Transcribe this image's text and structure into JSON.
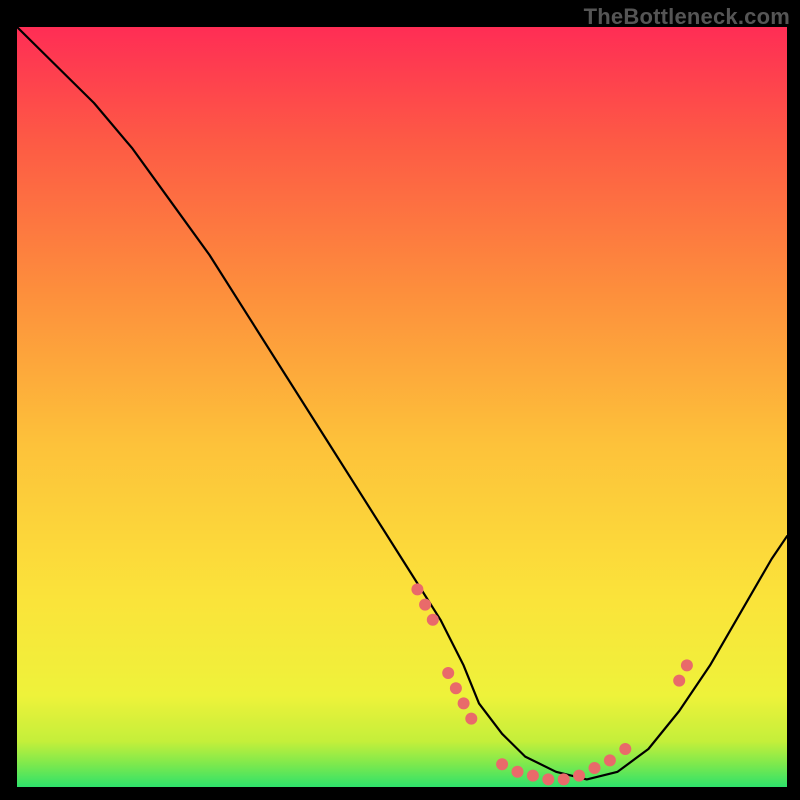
{
  "watermark": "TheBottleneck.com",
  "colors": {
    "page_bg": "#000000",
    "gradient_top": "#ff2d55",
    "gradient_mid": "#fbe33a",
    "gradient_bottom": "#2ee26b",
    "curve": "#000000",
    "dot": "#e96a6a"
  },
  "chart_data": {
    "type": "line",
    "title": "",
    "xlabel": "",
    "ylabel": "",
    "xlim": [
      0,
      100
    ],
    "ylim": [
      0,
      100
    ],
    "grid": false,
    "legend": false,
    "series": [
      {
        "name": "curve",
        "x": [
          0,
          5,
          10,
          15,
          20,
          25,
          30,
          35,
          40,
          45,
          50,
          55,
          58,
          60,
          63,
          66,
          70,
          74,
          78,
          82,
          86,
          90,
          94,
          98,
          100
        ],
        "y": [
          100,
          95,
          90,
          84,
          77,
          70,
          62,
          54,
          46,
          38,
          30,
          22,
          16,
          11,
          7,
          4,
          2,
          1,
          2,
          5,
          10,
          16,
          23,
          30,
          33
        ]
      }
    ],
    "dots": [
      {
        "x": 52,
        "y": 26
      },
      {
        "x": 53,
        "y": 24
      },
      {
        "x": 54,
        "y": 22
      },
      {
        "x": 56,
        "y": 15
      },
      {
        "x": 57,
        "y": 13
      },
      {
        "x": 58,
        "y": 11
      },
      {
        "x": 59,
        "y": 9
      },
      {
        "x": 63,
        "y": 3
      },
      {
        "x": 65,
        "y": 2
      },
      {
        "x": 67,
        "y": 1.5
      },
      {
        "x": 69,
        "y": 1
      },
      {
        "x": 71,
        "y": 1
      },
      {
        "x": 73,
        "y": 1.5
      },
      {
        "x": 75,
        "y": 2.5
      },
      {
        "x": 77,
        "y": 3.5
      },
      {
        "x": 79,
        "y": 5
      },
      {
        "x": 86,
        "y": 14
      },
      {
        "x": 87,
        "y": 16
      }
    ],
    "note": "No axis ticks or numeric labels are visible; x and y are read on a notional 0–100 scale of the plot area. Curve descends steeply from top-left, bottoms out near x≈72, then rises toward the right edge. Salmon dots cluster along the descent, flat minimum, and lower part of the ascent."
  }
}
